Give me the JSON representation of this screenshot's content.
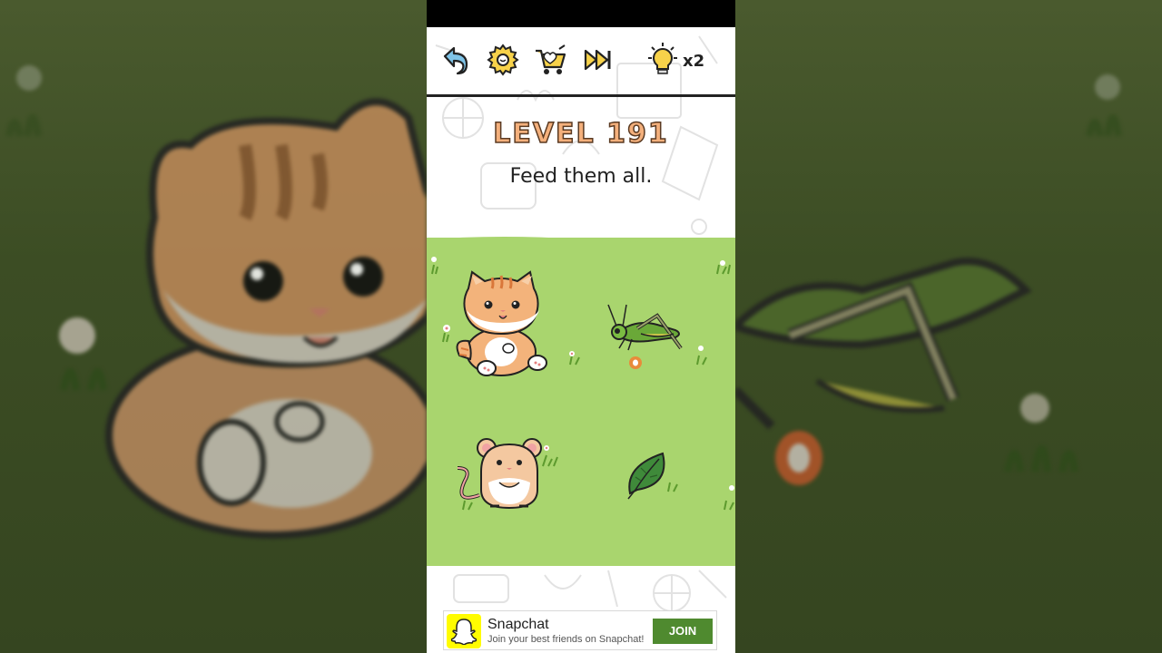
{
  "toolbar": {
    "hint_count": "x2"
  },
  "level": {
    "title": "LEVEL 191",
    "instruction": "Feed them all."
  },
  "ad": {
    "title": "Snapchat",
    "subtitle": "Join your best friends on Snapchat!",
    "cta": "JOIN"
  },
  "colors": {
    "grass": "#a9d56e",
    "level_title": "#f4b07c",
    "ad_button": "#4f8a2f",
    "snapchat_yellow": "#fffc00"
  },
  "icons": [
    "back-arrow-icon",
    "settings-gear-icon",
    "shop-cart-icon",
    "skip-icon",
    "lightbulb-hint-icon"
  ],
  "creatures": [
    "cat",
    "grasshopper",
    "mouse",
    "leaf"
  ]
}
